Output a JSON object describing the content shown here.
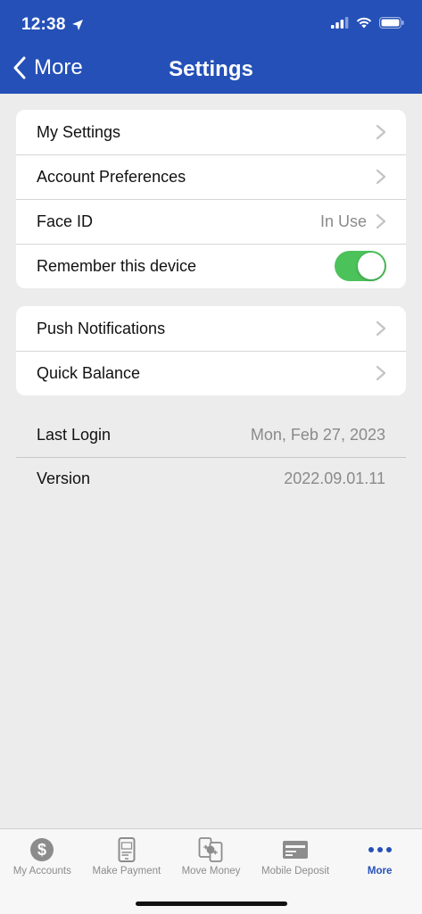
{
  "status_bar": {
    "time": "12:38"
  },
  "nav": {
    "back_label": "More",
    "title": "Settings"
  },
  "group1": [
    {
      "label": "My Settings",
      "value": ""
    },
    {
      "label": "Account Preferences",
      "value": ""
    },
    {
      "label": "Face ID",
      "value": "In Use"
    },
    {
      "label": "Remember this device",
      "toggle_on": true
    }
  ],
  "group2": [
    {
      "label": "Push Notifications"
    },
    {
      "label": "Quick Balance"
    }
  ],
  "info": [
    {
      "label": "Last Login",
      "value": "Mon, Feb 27, 2023"
    },
    {
      "label": "Version",
      "value": "2022.09.01.11"
    }
  ],
  "tabs": [
    {
      "label": "My Accounts",
      "icon": "dollar-circle-icon"
    },
    {
      "label": "Make Payment",
      "icon": "phone-pay-icon"
    },
    {
      "label": "Move Money",
      "icon": "transfer-phones-icon"
    },
    {
      "label": "Mobile Deposit",
      "icon": "check-card-icon"
    },
    {
      "label": "More",
      "icon": "more-dots-icon",
      "active": true
    }
  ],
  "colors": {
    "brand_blue": "#2550b8",
    "toggle_green": "#4cc25b",
    "background": "#ececec"
  }
}
